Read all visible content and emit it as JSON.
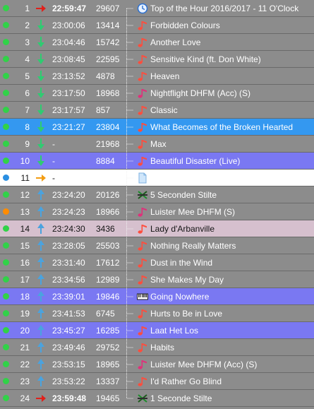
{
  "colors": {
    "row_bg": "#8c8c8c",
    "selected_bg": "#3498f0",
    "blue_bg": "#7a78f2",
    "pink_bg": "#d6c0ce",
    "white_bg": "#ffffff",
    "status_green": "#31d248",
    "status_blue": "#2a8fe2",
    "status_orange": "#ff8c00",
    "arrow_red": "#e0201a",
    "arrow_green": "#2ecc71",
    "arrow_orange": "#f39c12",
    "arrow_blue": "#4aa3df"
  },
  "rows": [
    {
      "num": "1",
      "time": "22:59:47",
      "bold": true,
      "duration": "29607",
      "title": "Top of the Hour 2016/2017 - 11 O'Clock",
      "status": "green",
      "arrow": "right-red",
      "icon": "clock-icon",
      "style": "normal"
    },
    {
      "num": "2",
      "time": "23:00:06",
      "bold": false,
      "duration": "13414",
      "title": "Forbidden Colours",
      "status": "green",
      "arrow": "down-green",
      "icon": "music-note-icon",
      "style": "normal"
    },
    {
      "num": "3",
      "time": "23:04:46",
      "bold": false,
      "duration": "15742",
      "title": "Another Love",
      "status": "green",
      "arrow": "down-green",
      "icon": "music-note-icon",
      "style": "normal"
    },
    {
      "num": "4",
      "time": "23:08:45",
      "bold": false,
      "duration": "22595",
      "title": "Sensitive Kind (ft. Don White)",
      "status": "green",
      "arrow": "down-green",
      "icon": "music-note-icon",
      "style": "normal"
    },
    {
      "num": "5",
      "time": "23:13:52",
      "bold": false,
      "duration": "4878",
      "title": "Heaven",
      "status": "green",
      "arrow": "down-green",
      "icon": "music-note-icon",
      "style": "normal"
    },
    {
      "num": "6",
      "time": "23:17:50",
      "bold": false,
      "duration": "18968",
      "title": "Nightflight DHFM (Acc) (S)",
      "status": "green",
      "arrow": "down-green",
      "icon": "music-note-pink-icon",
      "style": "normal"
    },
    {
      "num": "7",
      "time": "23:17:57",
      "bold": false,
      "duration": "857",
      "title": "Classic",
      "status": "green",
      "arrow": "down-green",
      "icon": "music-note-icon",
      "style": "normal"
    },
    {
      "num": "8",
      "time": "23:21:27",
      "bold": false,
      "duration": "23804",
      "title": "What Becomes of the Broken Hearted",
      "status": "green",
      "arrow": "down-green",
      "icon": "music-note-icon",
      "style": "selected"
    },
    {
      "num": "9",
      "time": "-",
      "bold": false,
      "duration": "21968",
      "title": "Max",
      "status": "green",
      "arrow": "down-green",
      "icon": "music-note-icon",
      "style": "normal"
    },
    {
      "num": "10",
      "time": "-",
      "bold": false,
      "duration": "8884",
      "title": "Beautiful Disaster (Live)",
      "status": "green",
      "arrow": "down-green",
      "icon": "music-note-icon",
      "style": "blue"
    },
    {
      "num": "11",
      "time": "-",
      "bold": false,
      "duration": "",
      "title": "",
      "status": "blue",
      "arrow": "right-orange",
      "icon": "document-icon",
      "style": "white"
    },
    {
      "num": "12",
      "time": "23:24:20",
      "bold": false,
      "duration": "20126",
      "title": "5 Seconden Stilte",
      "status": "green",
      "arrow": "up-blue",
      "icon": "silence-icon",
      "style": "normal"
    },
    {
      "num": "13",
      "time": "23:24:23",
      "bold": false,
      "duration": "18966",
      "title": "Luister Mee DHFM (S)",
      "status": "orange",
      "arrow": "up-blue",
      "icon": "music-note-pink-icon",
      "style": "normal"
    },
    {
      "num": "14",
      "time": "23:24:30",
      "bold": false,
      "duration": "3436",
      "title": "Lady d'Arbanville",
      "status": "green",
      "arrow": "up-blue",
      "icon": "music-note-icon",
      "style": "pink"
    },
    {
      "num": "15",
      "time": "23:28:05",
      "bold": false,
      "duration": "25503",
      "title": "Nothing Really Matters",
      "status": "green",
      "arrow": "up-blue",
      "icon": "music-note-icon",
      "style": "normal"
    },
    {
      "num": "16",
      "time": "23:31:40",
      "bold": false,
      "duration": "17612",
      "title": "Dust in the Wind",
      "status": "green",
      "arrow": "up-blue",
      "icon": "music-note-icon",
      "style": "normal"
    },
    {
      "num": "17",
      "time": "23:34:56",
      "bold": false,
      "duration": "12989",
      "title": "She Makes My Day",
      "status": "green",
      "arrow": "up-blue",
      "icon": "music-note-icon",
      "style": "normal"
    },
    {
      "num": "18",
      "time": "23:39:01",
      "bold": false,
      "duration": "19846",
      "title": "Going Nowhere",
      "status": "green",
      "arrow": "up-blue",
      "icon": "piano-icon",
      "style": "blue"
    },
    {
      "num": "19",
      "time": "23:41:53",
      "bold": false,
      "duration": "6745",
      "title": "Hurts to Be in Love",
      "status": "green",
      "arrow": "up-blue",
      "icon": "music-note-icon",
      "style": "normal"
    },
    {
      "num": "20",
      "time": "23:45:27",
      "bold": false,
      "duration": "16285",
      "title": "Laat Het Los",
      "status": "green",
      "arrow": "up-blue",
      "icon": "music-note-icon",
      "style": "blue"
    },
    {
      "num": "21",
      "time": "23:49:46",
      "bold": false,
      "duration": "29752",
      "title": "Habits",
      "status": "green",
      "arrow": "up-blue",
      "icon": "music-note-icon",
      "style": "normal"
    },
    {
      "num": "22",
      "time": "23:53:15",
      "bold": false,
      "duration": "18965",
      "title": "Luister Mee DHFM (Acc) (S)",
      "status": "green",
      "arrow": "up-blue",
      "icon": "music-note-pink-icon",
      "style": "normal"
    },
    {
      "num": "23",
      "time": "23:53:22",
      "bold": false,
      "duration": "13337",
      "title": "I'd Rather Go Blind",
      "status": "green",
      "arrow": "up-blue",
      "icon": "music-note-icon",
      "style": "normal"
    },
    {
      "num": "24",
      "time": "23:59:48",
      "bold": true,
      "duration": "19465",
      "title": "1 Seconde Stilte",
      "status": "green",
      "arrow": "right-red",
      "icon": "silence-icon",
      "style": "normal"
    }
  ]
}
